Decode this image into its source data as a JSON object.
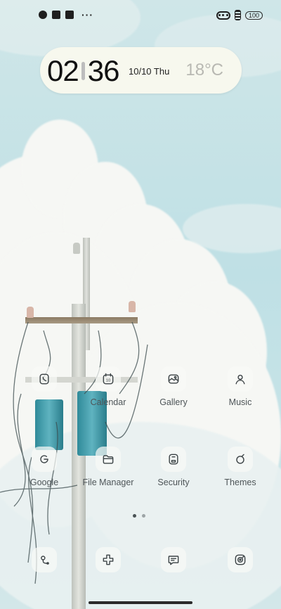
{
  "status_bar": {
    "left_icons": [
      "app-notification-icon",
      "square-notification-icon",
      "upload-notification-icon"
    ],
    "more": "···",
    "battery": "100"
  },
  "widget": {
    "hour": "02",
    "minute": "36",
    "date": "10/10 Thu",
    "temperature": "18°C"
  },
  "apps": {
    "row1": [
      {
        "label": "",
        "icon": "phone-icon"
      },
      {
        "label": "Calendar",
        "icon": "calendar-icon",
        "badge": "10"
      },
      {
        "label": "Gallery",
        "icon": "gallery-icon"
      },
      {
        "label": "Music",
        "icon": "music-icon"
      }
    ],
    "row2": [
      {
        "label": "Google",
        "icon": "google-icon"
      },
      {
        "label": "File Manager",
        "icon": "folder-icon"
      },
      {
        "label": "Security",
        "icon": "security-icon"
      },
      {
        "label": "Themes",
        "icon": "themes-icon"
      }
    ]
  },
  "dock": [
    {
      "icon": "maps-icon"
    },
    {
      "icon": "health-icon"
    },
    {
      "icon": "messages-icon"
    },
    {
      "icon": "music-player-icon"
    }
  ],
  "page_indicator": {
    "pages": 2,
    "active": 1
  },
  "colors": {
    "widget_bg": "#f7f8ee",
    "sky": "#c6e3e7",
    "icon_bg": "#f8f9f6",
    "label": "#4e5558"
  }
}
